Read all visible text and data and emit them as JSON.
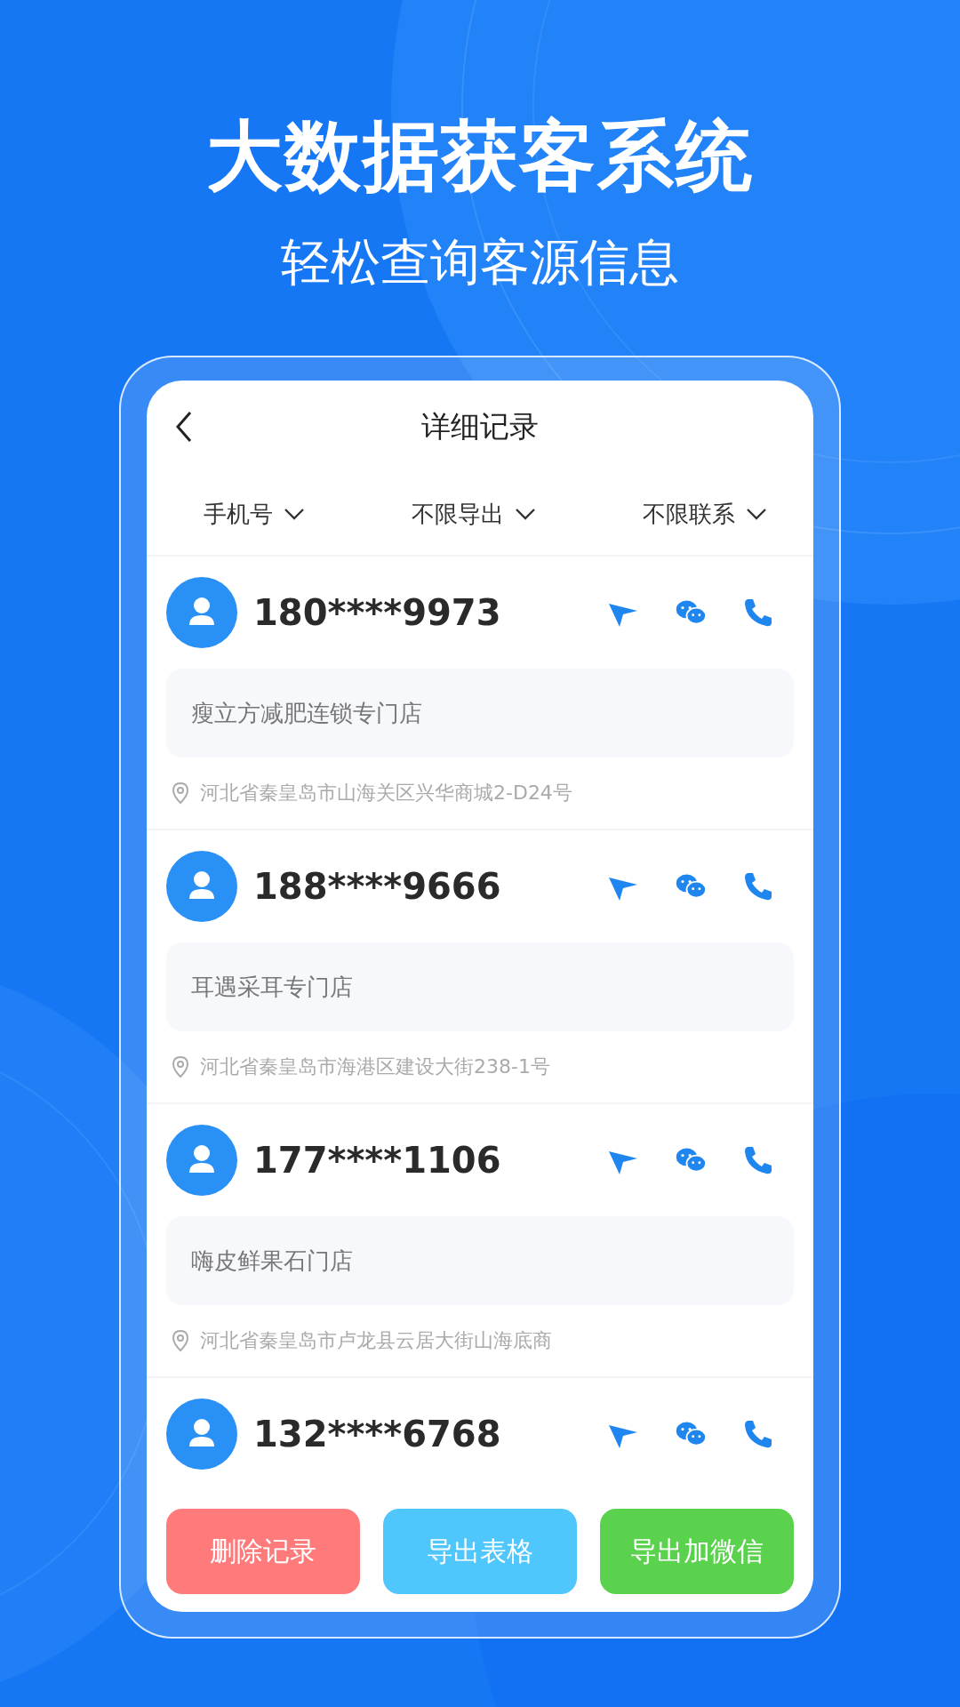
{
  "headline": "大数据获客系统",
  "subheadline": "轻松查询客源信息",
  "screen": {
    "title": "详细记录",
    "filters": [
      {
        "label": "手机号"
      },
      {
        "label": "不限导出"
      },
      {
        "label": "不限联系"
      }
    ],
    "records": [
      {
        "phone": "180****9973",
        "shop": "瘦立方减肥连锁专门店",
        "address": "河北省秦皇岛市山海关区兴华商城2-D24号"
      },
      {
        "phone": "188****9666",
        "shop": "耳遇采耳专门店",
        "address": "河北省秦皇岛市海港区建设大街238-1号"
      },
      {
        "phone": "177****1106",
        "shop": "嗨皮鲜果石门店",
        "address": "河北省秦皇岛市卢龙县云居大街山海底商"
      },
      {
        "phone": "132****6768"
      }
    ],
    "buttons": [
      {
        "label": "删除记录",
        "color": "#ff7b7b"
      },
      {
        "label": "导出表格",
        "color": "#4fc6fc"
      },
      {
        "label": "导出加微信",
        "color": "#5ad24e"
      }
    ]
  }
}
